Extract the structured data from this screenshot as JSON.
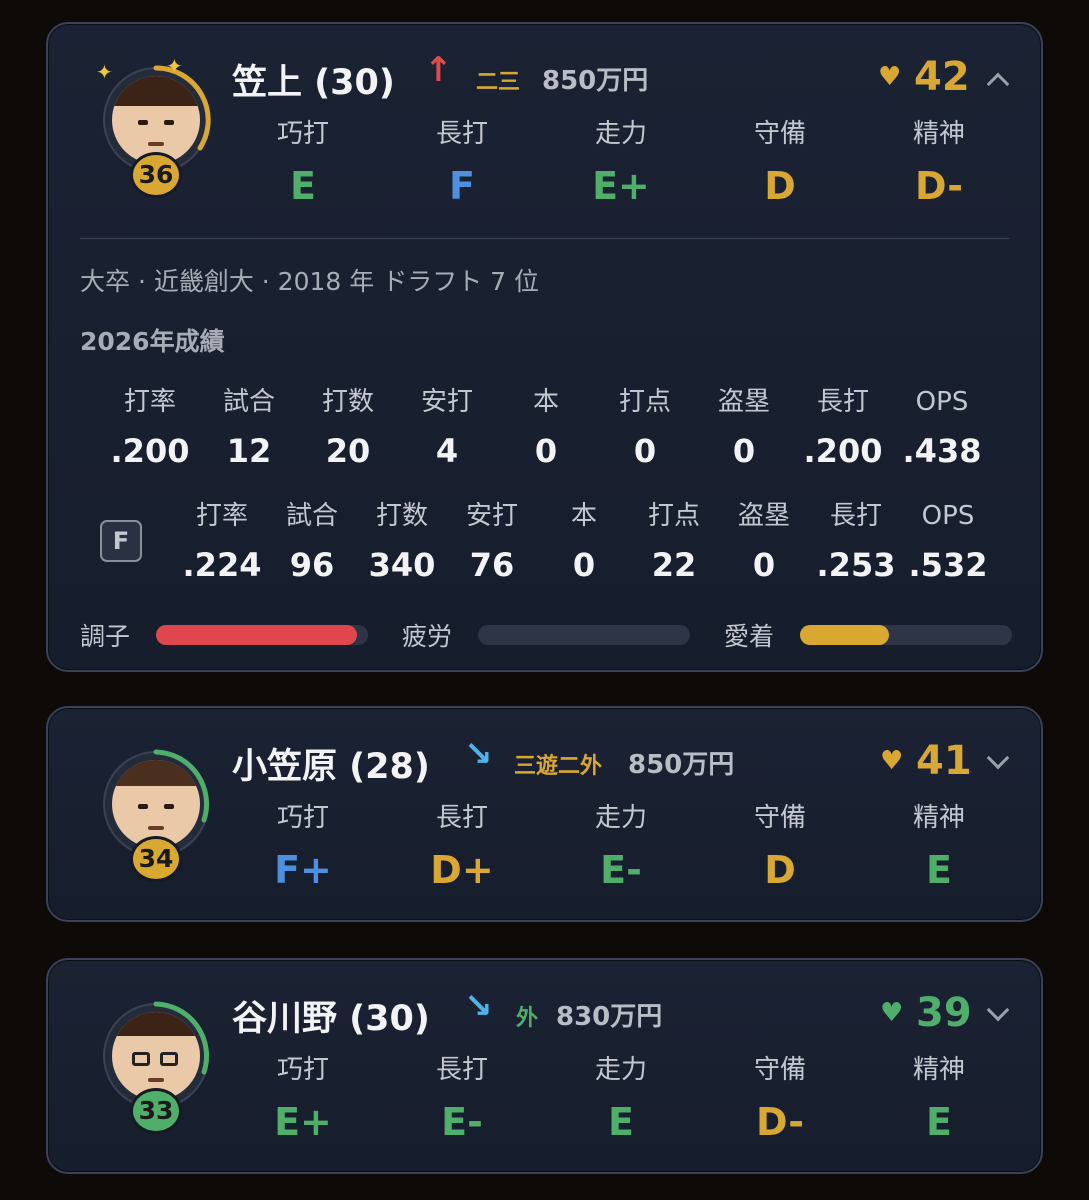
{
  "rating_labels": [
    "巧打",
    "長打",
    "走力",
    "守備",
    "精神"
  ],
  "stat_labels": [
    "打率",
    "試合",
    "打数",
    "安打",
    "本",
    "打点",
    "盗塁",
    "長打",
    "OPS"
  ],
  "players": [
    {
      "name": "笠上 (30)",
      "trend": "up",
      "trend_icon": "↑",
      "positions": "二三",
      "salary": "850万円",
      "affinity": "42",
      "number": "36",
      "expanded": true,
      "ratings": [
        "E",
        "F",
        "E+",
        "D",
        "D-"
      ],
      "bio": "大卒 · 近畿創大 · 2018 年 ドラフト 7 位",
      "season_title": "2026年成績",
      "season_stats": [
        ".200",
        "12",
        "20",
        "4",
        "0",
        "0",
        "0",
        ".200",
        ".438"
      ],
      "farm_label": "F",
      "farm_stats": [
        ".224",
        "96",
        "340",
        "76",
        "0",
        "22",
        "0",
        ".253",
        ".532"
      ],
      "bars": [
        {
          "label": "調子",
          "value": 0.95,
          "color": "#e0464d"
        },
        {
          "label": "疲労",
          "value": 0.0,
          "color": "#4a5264"
        },
        {
          "label": "愛着",
          "value": 0.42,
          "color": "#d9a832"
        }
      ]
    },
    {
      "name": "小笠原 (28)",
      "trend": "down",
      "trend_icon": "↘",
      "positions": "三遊二外",
      "salary": "850万円",
      "affinity": "41",
      "number": "34",
      "expanded": false,
      "ratings": [
        "F+",
        "D+",
        "E-",
        "D",
        "E"
      ]
    },
    {
      "name": "谷川野 (30)",
      "trend": "down",
      "trend_icon": "↘",
      "positions": "外",
      "salary": "830万円",
      "affinity": "39",
      "number": "33",
      "expanded": false,
      "ratings": [
        "E+",
        "E-",
        "E",
        "D-",
        "E"
      ]
    }
  ]
}
